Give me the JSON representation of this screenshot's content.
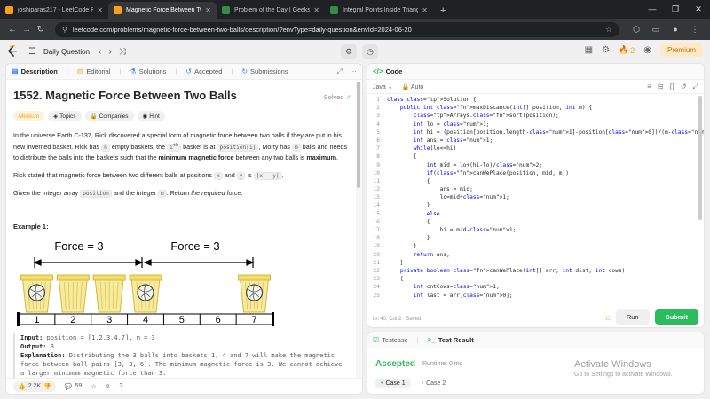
{
  "browser": {
    "tabs": [
      {
        "title": "joshiparas217 - LeetCode Profi",
        "active": false,
        "favcolor": "#ffa116"
      },
      {
        "title": "Magnetic Force Between Two B",
        "active": true,
        "favcolor": "#ffa116"
      },
      {
        "title": "Problem of the Day | GeeksforG",
        "active": false,
        "favcolor": "#2f8d46"
      },
      {
        "title": "Integral Points Inside Triangle |",
        "active": false,
        "favcolor": "#2f8d46"
      }
    ],
    "url": "leetcode.com/problems/magnetic-force-between-two-balls/description/?envType=daily-question&envId=2024-06-20"
  },
  "header": {
    "daily_label": "Daily Question",
    "streak": "2",
    "premium_label": "Premium"
  },
  "left_tabs": {
    "description": "Description",
    "editorial": "Editorial",
    "solutions": "Solutions",
    "accepted": "Accepted",
    "submissions": "Submissions"
  },
  "problem": {
    "title": "1552. Magnetic Force Between Two Balls",
    "solved_label": "Solved",
    "tags": [
      "Medium",
      "Topics",
      "Companies",
      "Hint"
    ],
    "p1_a": "In the universe Earth C-137, Rick discovered a special form of magnetic force between two balls if they are put in his new invented basket. Rick has ",
    "p1_n": "n",
    "p1_b": " empty baskets, the ",
    "p1_ith": "i",
    "p1_sup": "th",
    "p1_c": " basket is at ",
    "p1_pos": "position[i]",
    "p1_d": ", Morty has ",
    "p1_m": "m",
    "p1_e": " balls and needs to distribute the balls into the baskets such that the ",
    "p1_bold1": "minimum magnetic force",
    "p1_f": " between any two balls is ",
    "p1_bold2": "maximum",
    "p1_g": ".",
    "p2_a": "Rick stated that magnetic force between two different balls at positions ",
    "p2_x": "x",
    "p2_b": " and ",
    "p2_y": "y",
    "p2_c": " is ",
    "p2_abs": "|x - y|",
    "p2_d": ".",
    "p3_a": "Given the integer array ",
    "p3_pos": "position",
    "p3_b": " and the integer ",
    "p3_m": "m",
    "p3_c": ". Return ",
    "p3_it": "the required force",
    "p3_d": ".",
    "example_title": "Example 1:",
    "diagram": {
      "force_labels": [
        "Force = 3",
        "Force = 3"
      ],
      "positions": [
        "1",
        "2",
        "3",
        "4",
        "5",
        "6",
        "7"
      ]
    },
    "ex_input_label": "Input:",
    "ex_input": "position = [1,2,3,4,7], m = 3",
    "ex_output_label": "Output:",
    "ex_output": "3",
    "ex_expl_label": "Explanation:",
    "ex_expl": "Distributing the 3 balls into baskets 1, 4 and 7 will make the magnetic force between ball pairs [3, 3, 6]. The minimum magnetic force is 3. We cannot achieve a larger minimum magnetic force than 3."
  },
  "left_footer": {
    "likes": "2.2K",
    "comments": "59"
  },
  "code_panel": {
    "title": "Code",
    "language": "Java",
    "auto": "Auto",
    "status": "Ln 40, Col 2",
    "saved": "Saved",
    "run_label": "Run",
    "submit_label": "Submit",
    "lines": [
      "class Solution {",
      "    public int maxDistance(int[] position, int m) {",
      "        Arrays.sort(position);",
      "        int lo = 1;",
      "        int hi = (position[position.length-1]-position[0])/(m-1);",
      "        int ans = 1;",
      "        while(lo<=hi)",
      "        {",
      "            int mid = lo+(hi-lo)/2;",
      "            if(canWePlace(position, mid, m))",
      "            {",
      "                ans = mid;",
      "                lo=mid+1;",
      "            }",
      "            else",
      "            {",
      "                hi = mid-1;",
      "            }",
      "        }",
      "        return ans;",
      "    }",
      "    private boolean canWePlace(int[] arr, int dist, int cows)",
      "    {",
      "        int cntCows=1;",
      "        int last = arr[0];"
    ]
  },
  "test_panel": {
    "testcase_tab": "Testcase",
    "result_tab": "Test Result",
    "accepted": "Accepted",
    "runtime": "Runtime: 0 ms",
    "cases": [
      "Case 1",
      "Case 2"
    ]
  },
  "watermark": {
    "line1": "Activate Windows",
    "line2": "Go to Settings to activate Windows."
  }
}
